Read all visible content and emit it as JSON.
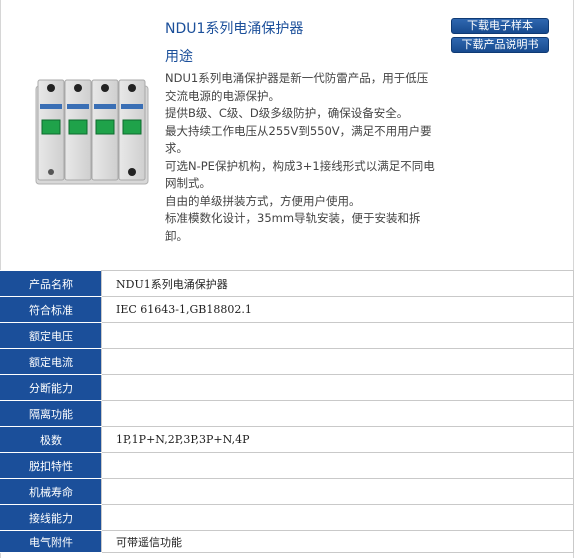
{
  "title": "NDU1系列电涌保护器",
  "usage_heading": "用途",
  "buttons": {
    "download_sample": "下载电子样本",
    "download_manual": "下载产品说明书"
  },
  "description": [
    "NDU1系列电涌保护器是新一代防雷产品，用于低压交流电源的电源保护。",
    "提供B级、C级、D级多级防护，确保设备安全。",
    "最大持续工作电压从255V到550V，满足不用用户要求。",
    "可选N-PE保护机构，构成3+1接线形式以满足不同电网制式。",
    "自由的单级拼装方式，方便用户使用。",
    "标准模数化设计，35mm导轨安装，便于安装和拆卸。"
  ],
  "colors": {
    "accent": "#1b4f9a",
    "button": "#174a8e"
  },
  "specs": [
    {
      "label": "产品名称",
      "value": "NDU1系列电涌保护器"
    },
    {
      "label": "符合标准",
      "value": "IEC 61643-1,GB18802.1"
    },
    {
      "label": "额定电压",
      "value": ""
    },
    {
      "label": "额定电流",
      "value": ""
    },
    {
      "label": "分断能力",
      "value": ""
    },
    {
      "label": "隔离功能",
      "value": ""
    },
    {
      "label": "极数",
      "value": "1P,1P+N,2P,3P,3P+N,4P"
    },
    {
      "label": "脱扣特性",
      "value": ""
    },
    {
      "label": "机械寿命",
      "value": ""
    },
    {
      "label": "接线能力",
      "value": ""
    },
    {
      "label": "电气附件",
      "value": "可带遥信功能"
    }
  ]
}
